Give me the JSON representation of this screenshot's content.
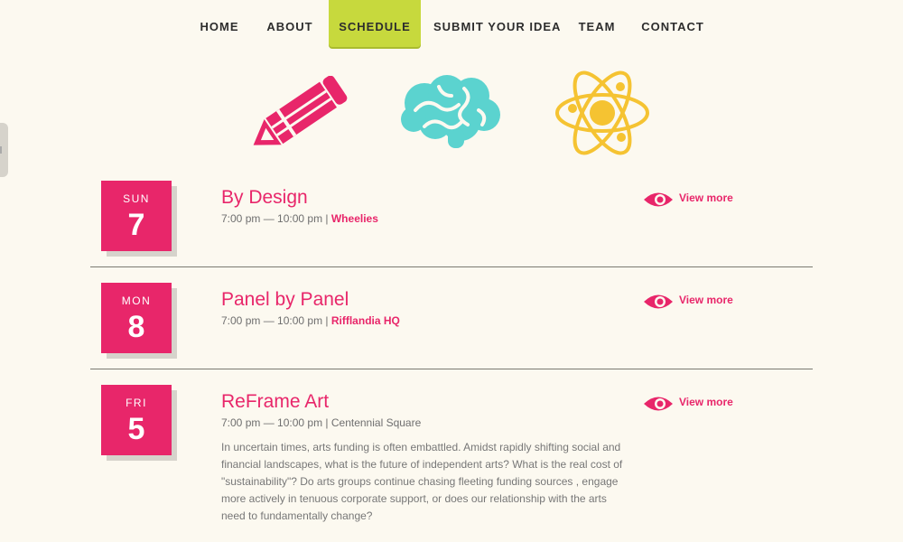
{
  "nav": {
    "items": [
      {
        "label": "HOME"
      },
      {
        "label": "ABOUT"
      },
      {
        "label": "SCHEDULE"
      },
      {
        "label": "SUBMIT YOUR IDEA"
      },
      {
        "label": "TEAM"
      },
      {
        "label": "CONTACT"
      }
    ],
    "active": "SCHEDULE",
    "active_color": "#c7d93d"
  },
  "hero_icons": [
    "pencil-icon",
    "brain-icon",
    "atom-icon"
  ],
  "colors": {
    "accent": "#e8266a",
    "brain": "#5bd3cf",
    "atom": "#f5c332",
    "background": "#fcf9f0"
  },
  "events": [
    {
      "dow": "SUN",
      "day": "7",
      "title": "By Design",
      "time": "7:00 pm — 10:00 pm",
      "sep": " | ",
      "venue": "Wheelies",
      "view_more": "View more"
    },
    {
      "dow": "MON",
      "day": "8",
      "title": "Panel by Panel",
      "time": "7:00 pm — 10:00 pm",
      "sep": " | ",
      "venue": "Rifflandia HQ",
      "view_more": "View more"
    },
    {
      "dow": "FRI",
      "day": "5",
      "title": "ReFrame Art",
      "time": "7:00 pm — 10:00 pm",
      "sep": " | ",
      "venue": "Centennial Square",
      "view_more": "View more",
      "description": "In uncertain times, arts funding is often embattled. Amidst rapidly shifting social and financial landscapes, what is the future of independent arts? What is the real cost of \"sustainability\"? Do arts groups continue chasing fleeting funding sources , engage more actively in tenuous corporate support, or does our relationship with the arts need to fundamentally change?"
    }
  ]
}
